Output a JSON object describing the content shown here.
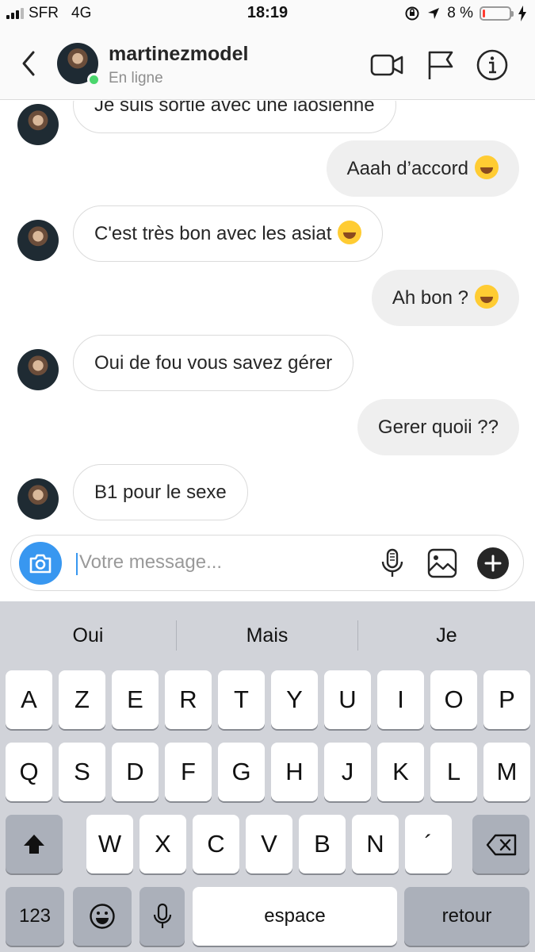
{
  "status_bar": {
    "carrier": "SFR",
    "network": "4G",
    "time": "18:19",
    "battery_percent": "8 %",
    "battery_level": 0.08,
    "battery_color": "#ff3b30"
  },
  "header": {
    "username": "martinezmodel",
    "presence": "En ligne",
    "icons": [
      "back-chevron-icon",
      "video-call-icon",
      "flag-icon",
      "info-icon"
    ]
  },
  "messages": [
    {
      "from": "them",
      "text": "Je suis sortie avec une laosienne",
      "emoji": null
    },
    {
      "from": "me",
      "text": "Aaah d’accord",
      "emoji": "tears-of-joy"
    },
    {
      "from": "them",
      "text": "C'est très bon avec les asiat",
      "emoji": "savoring-food"
    },
    {
      "from": "me",
      "text": "Ah bon ?",
      "emoji": "tears-of-joy"
    },
    {
      "from": "them",
      "text": "Oui de fou vous savez gérer",
      "emoji": null
    },
    {
      "from": "me",
      "text": "Gerer quoii ??",
      "emoji": null
    },
    {
      "from": "them",
      "text": "B1 pour le sexe",
      "emoji": null
    }
  ],
  "composer": {
    "placeholder": "Votre message...",
    "accent": "#3897f0",
    "icons": [
      "camera-icon",
      "microphone-icon",
      "gallery-icon",
      "plus-icon"
    ]
  },
  "keyboard": {
    "suggestions": [
      "Oui",
      "Mais",
      "Je"
    ],
    "row1": [
      "A",
      "Z",
      "E",
      "R",
      "T",
      "Y",
      "U",
      "I",
      "O",
      "P"
    ],
    "row2": [
      "Q",
      "S",
      "D",
      "F",
      "G",
      "H",
      "J",
      "K",
      "L",
      "M"
    ],
    "row3": [
      "W",
      "X",
      "C",
      "V",
      "B",
      "N",
      "´"
    ],
    "numbers_key": "123",
    "space_key": "espace",
    "return_key": "retour"
  }
}
